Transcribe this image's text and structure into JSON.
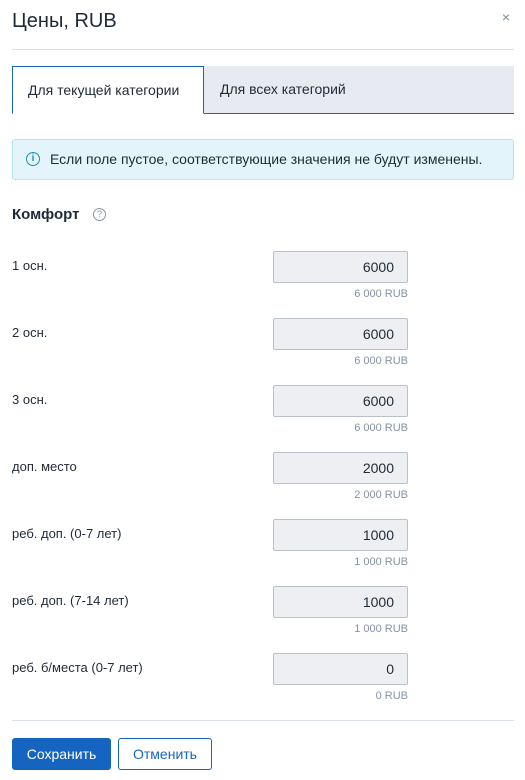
{
  "dialog": {
    "title": "Цены, RUB",
    "close_glyph": "×"
  },
  "tabs": [
    {
      "label": "Для текущей категории",
      "active": true
    },
    {
      "label": "Для всех категорий",
      "active": false
    }
  ],
  "info": {
    "icon": "info-icon",
    "text": "Если поле пустое, соответствующие значения не будут изменены."
  },
  "section": {
    "title": "Комфорт",
    "help_icon": "help-icon"
  },
  "rows": [
    {
      "label": "1 осн.",
      "value": "6000",
      "hint": "6 000 RUB"
    },
    {
      "label": "2 осн.",
      "value": "6000",
      "hint": "6 000 RUB"
    },
    {
      "label": "3 осн.",
      "value": "6000",
      "hint": "6 000 RUB"
    },
    {
      "label": "доп. место",
      "value": "2000",
      "hint": "2 000 RUB"
    },
    {
      "label": "реб. доп. (0-7 лет)",
      "value": "1000",
      "hint": "1 000 RUB"
    },
    {
      "label": "реб. доп. (7-14 лет)",
      "value": "1000",
      "hint": "1 000 RUB"
    },
    {
      "label": "реб. б/места (0-7 лет)",
      "value": "0",
      "hint": "0 RUB"
    }
  ],
  "footer": {
    "save_label": "Сохранить",
    "cancel_label": "Отменить"
  },
  "colors": {
    "accent": "#1565c0",
    "info_bg": "#e3f5fb",
    "input_bg": "#edeff2"
  }
}
